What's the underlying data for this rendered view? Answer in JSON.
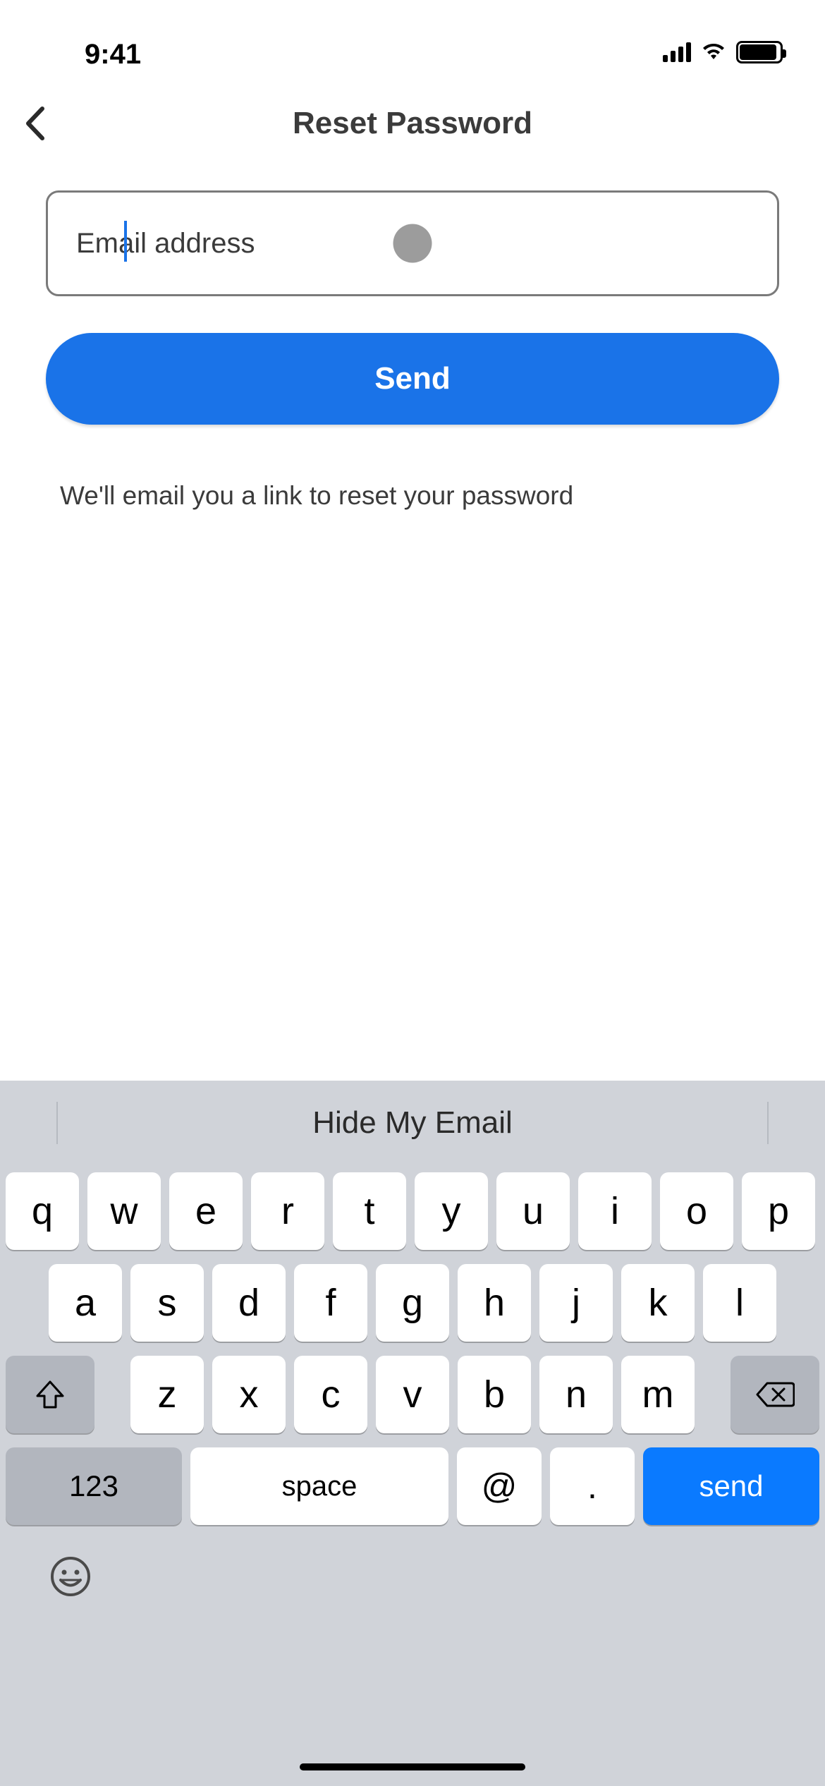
{
  "status_bar": {
    "time": "9:41"
  },
  "header": {
    "title": "Reset Password"
  },
  "form": {
    "email_placeholder": "Email address",
    "email_value": "",
    "send_label": "Send",
    "helper_text": "We'll email you a link to reset your password"
  },
  "keyboard": {
    "suggestion": "Hide My Email",
    "row1": [
      "q",
      "w",
      "e",
      "r",
      "t",
      "y",
      "u",
      "i",
      "o",
      "p"
    ],
    "row2": [
      "a",
      "s",
      "d",
      "f",
      "g",
      "h",
      "j",
      "k",
      "l"
    ],
    "row3": [
      "z",
      "x",
      "c",
      "v",
      "b",
      "n",
      "m"
    ],
    "num_key": "123",
    "space_label": "space",
    "at_key": "@",
    "dot_key": ".",
    "send_key": "send"
  }
}
